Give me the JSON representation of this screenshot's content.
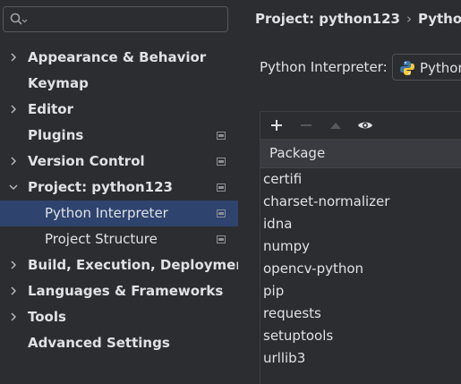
{
  "search": {
    "placeholder": "",
    "value": ""
  },
  "sidebar": {
    "items": [
      {
        "label": "Appearance & Behavior",
        "chevron": "right",
        "project_icon": false
      },
      {
        "label": "Keymap",
        "chevron": "none",
        "project_icon": false
      },
      {
        "label": "Editor",
        "chevron": "right",
        "project_icon": false
      },
      {
        "label": "Plugins",
        "chevron": "none",
        "project_icon": true
      },
      {
        "label": "Version Control",
        "chevron": "right",
        "project_icon": true
      },
      {
        "label": "Project: python123",
        "chevron": "down",
        "project_icon": true
      },
      {
        "label": "Python Interpreter",
        "chevron": "none",
        "project_icon": true,
        "child": true,
        "selected": true
      },
      {
        "label": "Project Structure",
        "chevron": "none",
        "project_icon": true,
        "child": true
      },
      {
        "label": "Build, Execution, Deployment",
        "chevron": "right",
        "project_icon": false
      },
      {
        "label": "Languages & Frameworks",
        "chevron": "right",
        "project_icon": false
      },
      {
        "label": "Tools",
        "chevron": "right",
        "project_icon": false
      },
      {
        "label": "Advanced Settings",
        "chevron": "none",
        "project_icon": false
      }
    ]
  },
  "breadcrumb": {
    "project": "Project: python123",
    "separator": "›",
    "page": "Python I"
  },
  "interpreter": {
    "label": "Python Interpreter:",
    "value": "Python"
  },
  "packages": {
    "toolbar": {
      "add_icon": "plus-icon",
      "remove_icon": "minus-icon",
      "upgrade_icon": "triangle-up-icon",
      "show_icon": "eye-icon"
    },
    "column_header": "Package",
    "rows": [
      "certifi",
      "charset-normalizer",
      "idna",
      "numpy",
      "opencv-python",
      "pip",
      "requests",
      "setuptools",
      "urllib3"
    ]
  },
  "colors": {
    "selected_bg": "#2e436e",
    "panel_bg": "#2b2d30",
    "header_bg": "#393b40",
    "text": "#dfe1e5"
  }
}
